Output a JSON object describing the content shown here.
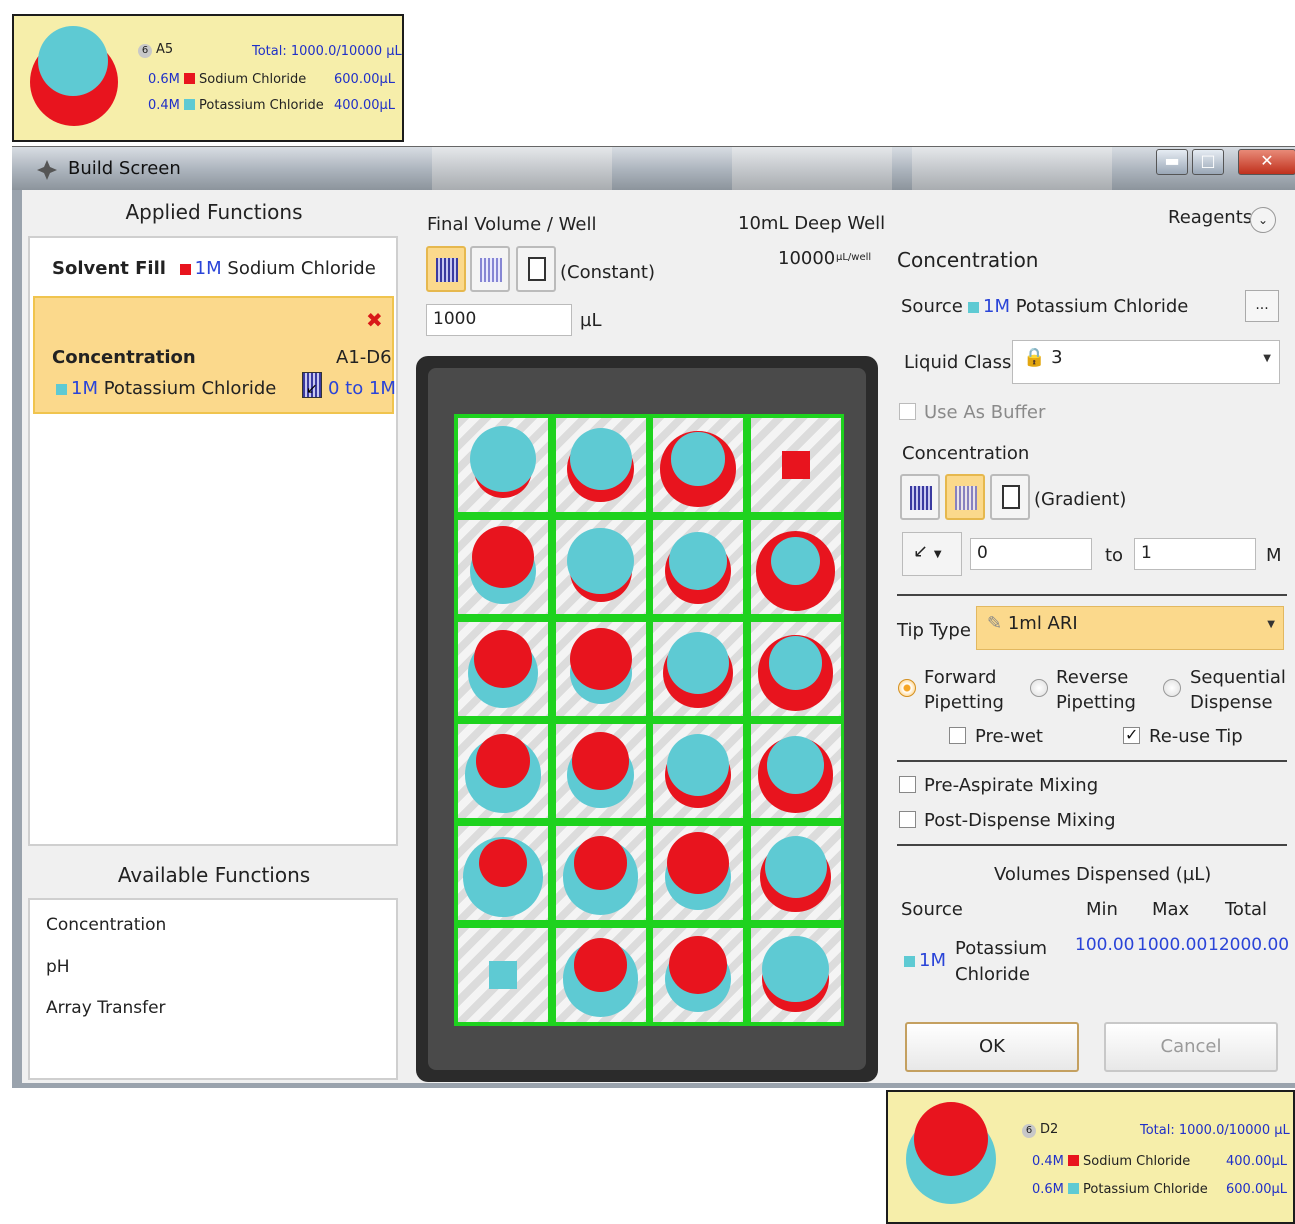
{
  "tooltip_top": {
    "badge": "6",
    "well": "A5",
    "total": "Total: 1000.0/10000 µL",
    "rows": [
      {
        "conc": "0.6M",
        "color": "#e8141e",
        "name": "Sodium Chloride",
        "vol": "600.00µL"
      },
      {
        "conc": "0.4M",
        "color": "#5ecad3",
        "name": "Potassium Chloride",
        "vol": "400.00µL"
      }
    ]
  },
  "tooltip_bottom": {
    "badge": "6",
    "well": "D2",
    "total": "Total: 1000.0/10000 µL",
    "rows": [
      {
        "conc": "0.4M",
        "color": "#e8141e",
        "name": "Sodium Chloride",
        "vol": "400.00µL"
      },
      {
        "conc": "0.6M",
        "color": "#5ecad3",
        "name": "Potassium Chloride",
        "vol": "600.00µL"
      }
    ]
  },
  "window": {
    "title": "Build Screen",
    "minimize": "▬",
    "maximize": "□",
    "close": "✕"
  },
  "applied": {
    "header": "Applied Functions",
    "solvent_label": "Solvent Fill",
    "solvent_conc": "1M",
    "solvent_name": "Sodium Chloride",
    "card_title": "Concentration",
    "card_range": "A1-D6",
    "card_conc": "1M",
    "card_reagent": "Potassium Chloride",
    "card_gradient": "0 to 1M",
    "delete_icon": "✖"
  },
  "available": {
    "header": "Available Functions",
    "items": [
      "Concentration",
      "pH",
      "Array Transfer"
    ]
  },
  "middle": {
    "final_volume_label": "Final Volume / Well",
    "plate_type": "10mL Deep Well",
    "plate_capacity": "10000",
    "capacity_unit": "µL/well",
    "mode_label": "(Constant)",
    "volume_value": "1000",
    "volume_unit": "µL"
  },
  "plate": {
    "columns": 4,
    "rows": 6,
    "red": "#e8141e",
    "cyan": "#5ecad3",
    "wells": [
      [
        {
          "r": 0.4,
          "c": 0.6,
          "top": "c"
        },
        {
          "r": 0.6,
          "c": 0.5,
          "top": "c"
        },
        {
          "r": 0.8,
          "c": 0.3,
          "top": "c"
        },
        {
          "r": 0,
          "c": 0,
          "top": "sq-red"
        }
      ],
      [
        {
          "r": 0.5,
          "c": 0.6,
          "top": "r"
        },
        {
          "r": 0.5,
          "c": 0.6,
          "top": "c"
        },
        {
          "r": 0.6,
          "c": 0.4,
          "top": "c"
        },
        {
          "r": 0.9,
          "c": 0.2,
          "top": "c"
        }
      ],
      [
        {
          "r": 0.4,
          "c": 0.7,
          "top": "r"
        },
        {
          "r": 0.5,
          "c": 0.5,
          "top": "r"
        },
        {
          "r": 0.7,
          "c": 0.5,
          "top": "c"
        },
        {
          "r": 0.8,
          "c": 0.3,
          "top": "c"
        }
      ],
      [
        {
          "r": 0.3,
          "c": 0.8,
          "top": "r"
        },
        {
          "r": 0.4,
          "c": 0.6,
          "top": "r"
        },
        {
          "r": 0.6,
          "c": 0.5,
          "top": "c"
        },
        {
          "r": 0.8,
          "c": 0.4,
          "top": "c"
        }
      ],
      [
        {
          "r": 0.2,
          "c": 0.9,
          "top": "r"
        },
        {
          "r": 0.3,
          "c": 0.8,
          "top": "r"
        },
        {
          "r": 0.5,
          "c": 0.6,
          "top": "r"
        },
        {
          "r": 0.7,
          "c": 0.5,
          "top": "c"
        }
      ],
      [
        {
          "r": 0,
          "c": 0,
          "top": "sq-cyan"
        },
        {
          "r": 0.3,
          "c": 0.8,
          "top": "r"
        },
        {
          "r": 0.4,
          "c": 0.6,
          "top": "r"
        },
        {
          "r": 0.6,
          "c": 0.6,
          "top": "c"
        }
      ]
    ]
  },
  "right": {
    "reagents_label": "Reagents",
    "section_title": "Concentration",
    "source_label": "Source",
    "source_conc": "1M",
    "source_name": "Potassium Chloride",
    "browse_label": "...",
    "liquid_class_label": "Liquid Class",
    "liquid_class_value": "3",
    "use_as_buffer": "Use As Buffer",
    "conc_label": "Concentration",
    "gradient_label": "(Gradient)",
    "from_value": "0",
    "to_label": "to",
    "to_value": "1",
    "unit": "M",
    "tip_type_label": "Tip Type",
    "tip_type_value": "1ml ARI",
    "forward": [
      "Forward",
      "Pipetting"
    ],
    "reverse": [
      "Reverse",
      "Pipetting"
    ],
    "sequential": [
      "Sequential",
      "Dispense"
    ],
    "prewet": "Pre-wet",
    "reuse": "Re-use Tip",
    "pre_aspirate": "Pre-Aspirate Mixing",
    "post_dispense": "Post-Dispense Mixing",
    "volumes_title": "Volumes Dispensed (µL)",
    "col_source": "Source",
    "col_min": "Min",
    "col_max": "Max",
    "col_total": "Total",
    "row_conc": "1M",
    "row_name_1": "Potassium",
    "row_name_2": "Chloride",
    "row_min": "100.00",
    "row_max": "1000.00",
    "row_total": "12000.00",
    "ok": "OK",
    "cancel": "Cancel"
  }
}
